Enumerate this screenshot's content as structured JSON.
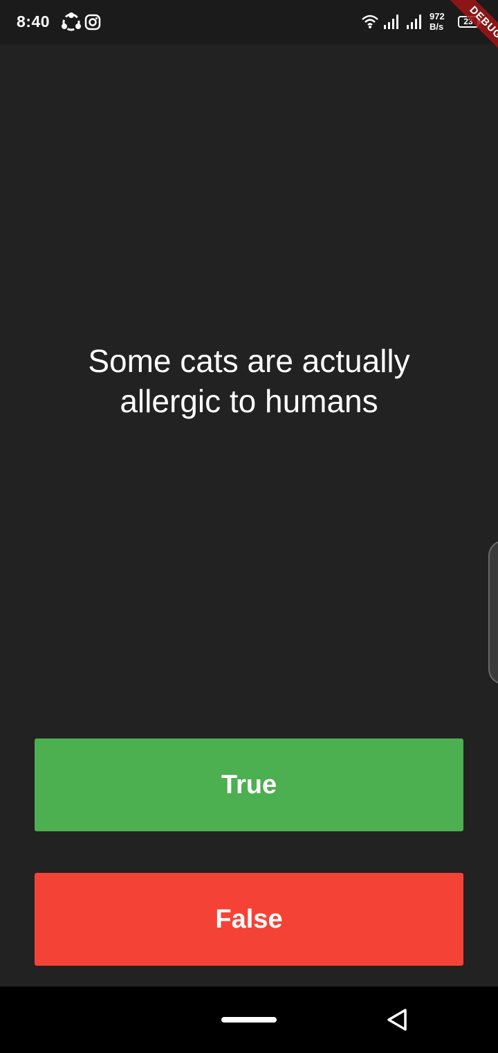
{
  "status_bar": {
    "time": "8:40",
    "net_speed_value": "972",
    "net_speed_unit": "B/s",
    "battery_level": "23",
    "icons": [
      "share-it-icon",
      "instagram-icon",
      "wifi-icon",
      "signal-icon",
      "signal-icon",
      "battery-icon"
    ]
  },
  "debug_banner": {
    "label": "DEBUG"
  },
  "quiz": {
    "question": "Some cats are actually allergic to humans",
    "true_label": "True",
    "false_label": "False"
  },
  "colors": {
    "background": "#222222",
    "true_button": "#4caf50",
    "false_button": "#f44336",
    "debug_banner": "#a01414"
  },
  "nav_bar": {
    "icons": [
      "home-pill-icon",
      "back-icon"
    ]
  }
}
